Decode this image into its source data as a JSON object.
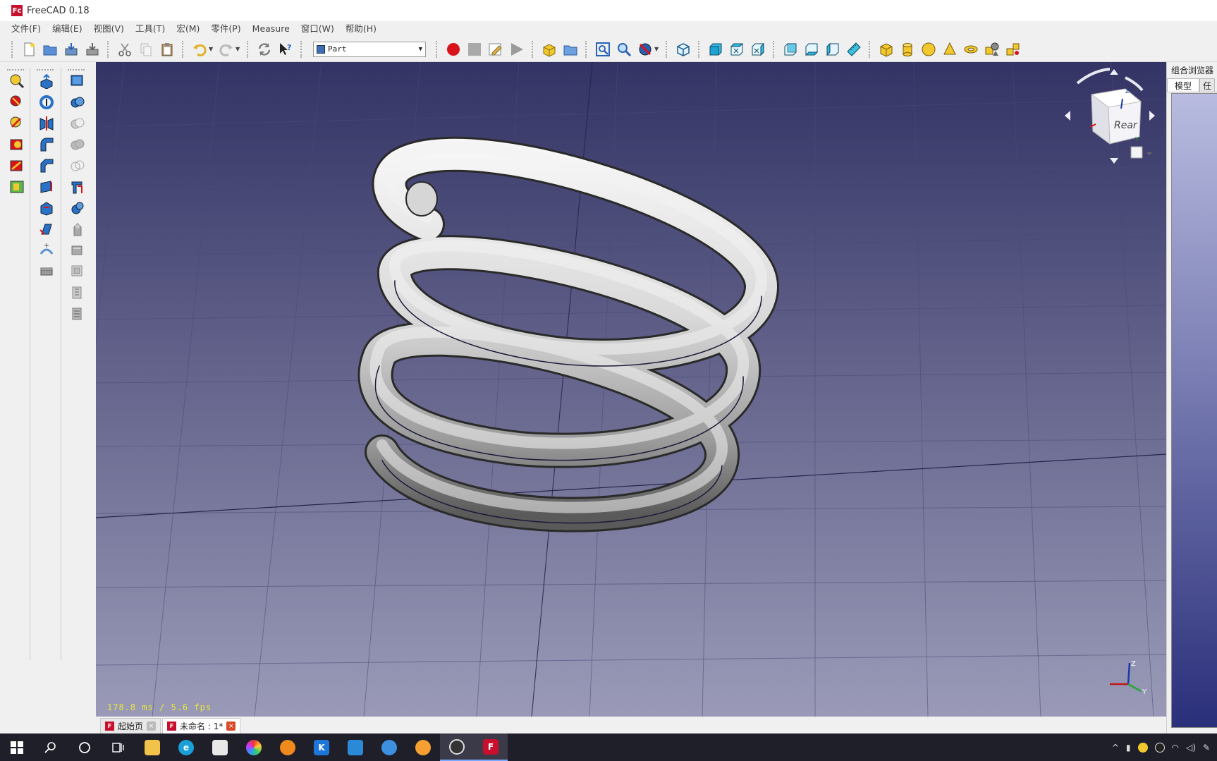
{
  "window": {
    "title": "FreeCAD 0.18",
    "logo_text": "Fc"
  },
  "menu": [
    "文件(F)",
    "编辑(E)",
    "视图(V)",
    "工具(T)",
    "宏(M)",
    "零件(P)",
    "Measure",
    "窗口(W)",
    "帮助(H)"
  ],
  "toolbar": {
    "workbench": "Part"
  },
  "viewport": {
    "fps_text": "178.8 ms / 5.6 fps",
    "navcube_face": "Rear",
    "axes": {
      "z": "Z",
      "y": "Y",
      "cube_z": "Z",
      "cube_y": "Y"
    }
  },
  "doc_tabs": [
    {
      "label": "起始页",
      "active": false
    },
    {
      "label": "未命名 : 1*",
      "active": true
    }
  ],
  "combo_view": {
    "title": "组合浏览器",
    "tab_model": "模型",
    "tab_task": "任"
  },
  "taskbar": {
    "apps": [
      "start",
      "search",
      "cortana",
      "task-view",
      "explorer",
      "edge",
      "store",
      "photos",
      "blender",
      "kodi",
      "photos-app",
      "feishu",
      "bilibili",
      "obs",
      "freecad"
    ]
  },
  "colors": {
    "viewport_top": "#333365",
    "viewport_bottom": "#9a9ab8",
    "fps": "#e6e63a",
    "accent": "#c8102e"
  }
}
